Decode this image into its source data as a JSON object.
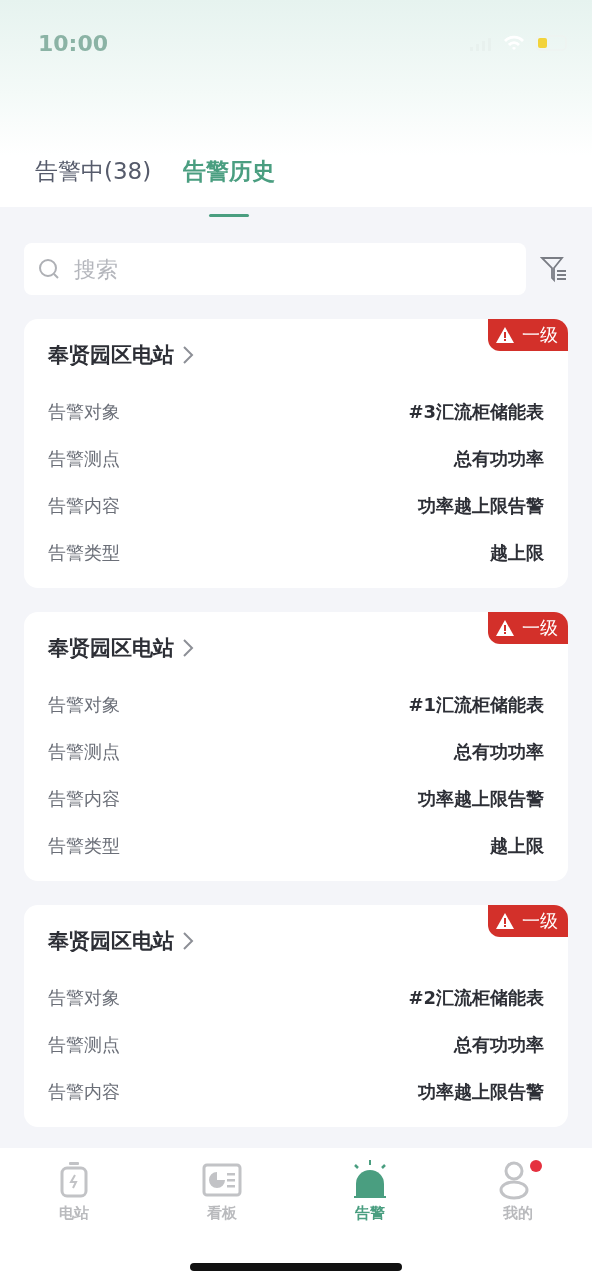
{
  "status_bar": {
    "time": "10:00"
  },
  "tabs": [
    {
      "label": "告警中(38)",
      "selected": false
    },
    {
      "label": "告警历史",
      "selected": true
    }
  ],
  "search": {
    "placeholder": "搜索"
  },
  "alarms": [
    {
      "station": "奉贤园区电站",
      "level": "一级",
      "fields": [
        {
          "label": "告警对象",
          "value": "#3汇流柜储能表"
        },
        {
          "label": "告警测点",
          "value": "总有功功率"
        },
        {
          "label": "告警内容",
          "value": "功率越上限告警"
        },
        {
          "label": "告警类型",
          "value": "越上限"
        }
      ]
    },
    {
      "station": "奉贤园区电站",
      "level": "一级",
      "fields": [
        {
          "label": "告警对象",
          "value": "#1汇流柜储能表"
        },
        {
          "label": "告警测点",
          "value": "总有功功率"
        },
        {
          "label": "告警内容",
          "value": "功率越上限告警"
        },
        {
          "label": "告警类型",
          "value": "越上限"
        }
      ]
    },
    {
      "station": "奉贤园区电站",
      "level": "一级",
      "fields": [
        {
          "label": "告警对象",
          "value": "#2汇流柜储能表"
        },
        {
          "label": "告警测点",
          "value": "总有功功率"
        },
        {
          "label": "告警内容",
          "value": "功率越上限告警"
        }
      ]
    }
  ],
  "nav": [
    {
      "kind": "station",
      "label": "电站",
      "selected": false,
      "badge": false
    },
    {
      "kind": "board",
      "label": "看板",
      "selected": false,
      "badge": false
    },
    {
      "kind": "alarm",
      "label": "告警",
      "selected": true,
      "badge": false
    },
    {
      "kind": "me",
      "label": "我的",
      "selected": false,
      "badge": true
    }
  ]
}
